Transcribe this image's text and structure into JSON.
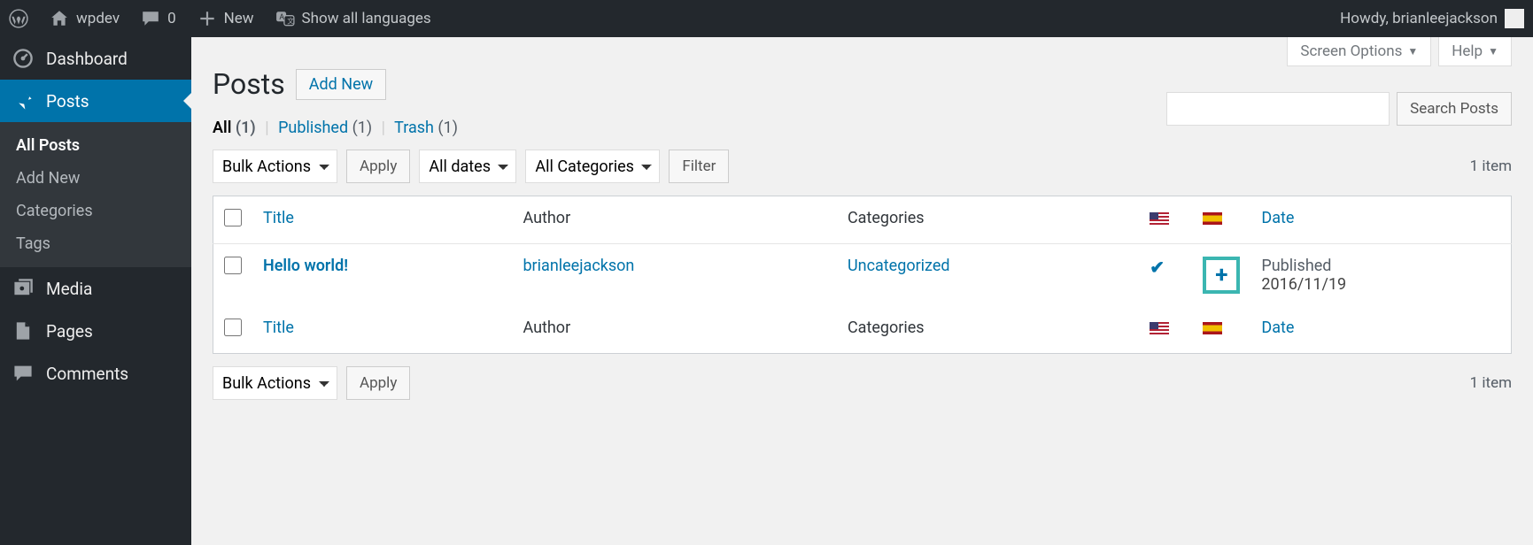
{
  "adminbar": {
    "site_name": "wpdev",
    "comments_count": "0",
    "new_label": "New",
    "languages_label": "Show all languages",
    "howdy": "Howdy, brianleejackson"
  },
  "sidebar": {
    "items": [
      {
        "label": "Dashboard"
      },
      {
        "label": "Posts"
      },
      {
        "label": "Media"
      },
      {
        "label": "Pages"
      },
      {
        "label": "Comments"
      }
    ],
    "submenu": [
      {
        "label": "All Posts"
      },
      {
        "label": "Add New"
      },
      {
        "label": "Categories"
      },
      {
        "label": "Tags"
      }
    ]
  },
  "top_tabs": {
    "screen_options": "Screen Options",
    "help": "Help"
  },
  "page": {
    "title": "Posts",
    "add_new": "Add New"
  },
  "filters": {
    "all": "All",
    "all_count": "(1)",
    "published": "Published",
    "published_count": "(1)",
    "trash": "Trash",
    "trash_count": "(1)"
  },
  "controls": {
    "bulk_actions": "Bulk Actions",
    "apply": "Apply",
    "all_dates": "All dates",
    "all_categories": "All Categories",
    "filter": "Filter",
    "search": "Search Posts",
    "items_count": "1 item"
  },
  "columns": {
    "title": "Title",
    "author": "Author",
    "categories": "Categories",
    "date": "Date"
  },
  "rows": [
    {
      "title": "Hello world!",
      "author": "brianleejackson",
      "categories": "Uncategorized",
      "lang_us": "check",
      "lang_es": "plus",
      "date_status": "Published",
      "date_value": "2016/11/19"
    }
  ]
}
